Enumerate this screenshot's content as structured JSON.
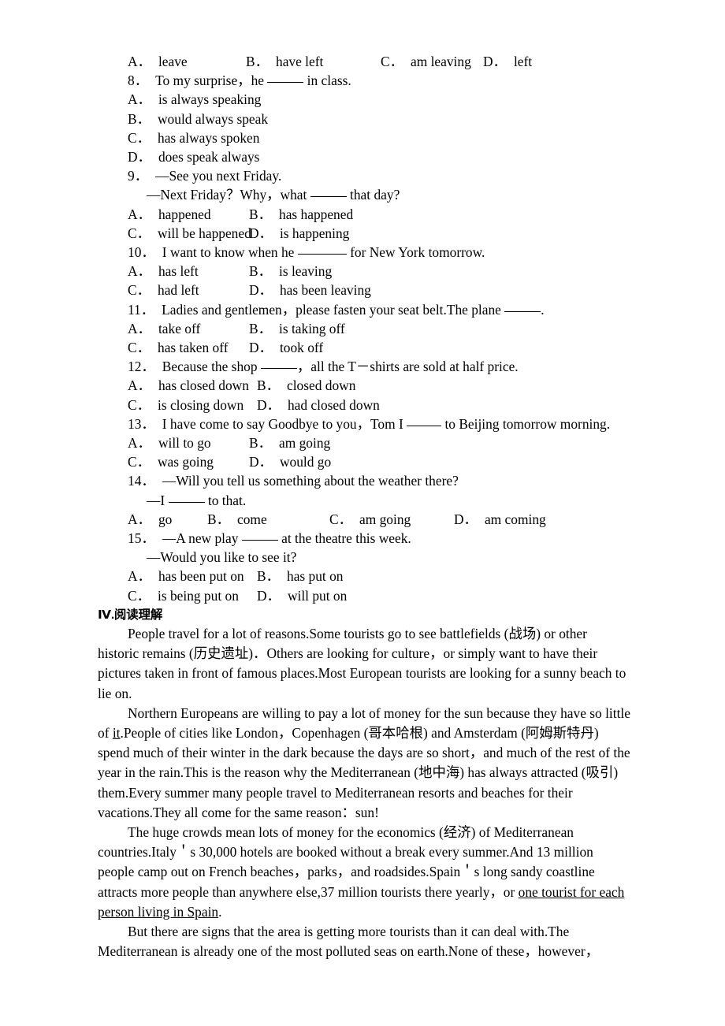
{
  "document": {
    "questions": [
      {
        "id": "q7-options",
        "type": "options-4col",
        "options": [
          {
            "key": "A．",
            "text": "leave"
          },
          {
            "key": "B．",
            "text": "have left"
          },
          {
            "key": "C．",
            "text": "am leaving"
          },
          {
            "key": "D．",
            "text": "left"
          }
        ]
      },
      {
        "id": "q8",
        "number": "8．",
        "stem_before": "To my surprise，he ",
        "stem_after": " in class.",
        "type": "stacked",
        "options": [
          {
            "key": "A．",
            "text": "is always speaking"
          },
          {
            "key": "B．",
            "text": "would always speak"
          },
          {
            "key": "C．",
            "text": "has always spoken"
          },
          {
            "key": "D．",
            "text": "does speak always"
          }
        ]
      },
      {
        "id": "q9",
        "number": "9．",
        "stem_line1": "—See you next Friday.",
        "stem_line2_before": "—Next Friday？Why，what ",
        "stem_line2_after": " that day?",
        "type": "2col",
        "options": [
          {
            "key": "A．",
            "text": "happened"
          },
          {
            "key": "B．",
            "text": "has happened"
          },
          {
            "key": "C．",
            "text": "will be happened"
          },
          {
            "key": "D．",
            "text": "is happening"
          }
        ]
      },
      {
        "id": "q10",
        "number": "10．",
        "stem_before": "I want to know when he ",
        "stem_after": " for New York tomorrow.",
        "type": "2col",
        "options": [
          {
            "key": "A．",
            "text": "has left"
          },
          {
            "key": "B．",
            "text": "is leaving"
          },
          {
            "key": "C．",
            "text": "had left"
          },
          {
            "key": "D．",
            "text": "has been leaving"
          }
        ]
      },
      {
        "id": "q11",
        "number": "11．",
        "stem_before": "Ladies and gentlemen，please fasten your seat belt.The plane ",
        "stem_after": ".",
        "type": "2col",
        "options": [
          {
            "key": "A．",
            "text": "take off"
          },
          {
            "key": "B．",
            "text": "is taking off"
          },
          {
            "key": "C．",
            "text": "has taken off"
          },
          {
            "key": "D．",
            "text": "took off"
          }
        ]
      },
      {
        "id": "q12",
        "number": "12．",
        "stem_before": "Because the shop ",
        "stem_after": "，all the T－shirts are sold at half price.",
        "type": "2col",
        "options": [
          {
            "key": "A．",
            "text": "has closed down"
          },
          {
            "key": "B．",
            "text": "closed down"
          },
          {
            "key": "C．",
            "text": "is closing down"
          },
          {
            "key": "D．",
            "text": "had closed down"
          }
        ]
      },
      {
        "id": "q13",
        "number": "13．",
        "stem_before": "I have come to say Goodbye to you，Tom I ",
        "stem_after": " to Beijing tomorrow morning.",
        "type": "2col",
        "options": [
          {
            "key": "A．",
            "text": "will to go"
          },
          {
            "key": "B．",
            "text": "am going"
          },
          {
            "key": "C．",
            "text": "was going"
          },
          {
            "key": "D．",
            "text": "would go"
          }
        ]
      },
      {
        "id": "q14",
        "number": "14．",
        "stem_line1": "—Will you tell us something about the weather there?",
        "stem_line2_before": "—I ",
        "stem_line2_after": " to that.",
        "type": "options-4col",
        "options": [
          {
            "key": "A．",
            "text": "go"
          },
          {
            "key": "B．",
            "text": "come"
          },
          {
            "key": "C．",
            "text": "am going"
          },
          {
            "key": "D．",
            "text": "am coming"
          }
        ]
      },
      {
        "id": "q15",
        "number": "15．",
        "stem_line1_before": "—A new play ",
        "stem_line1_after": " at the theatre this week.",
        "stem_line2": "—Would you like to see it?",
        "type": "2col",
        "options": [
          {
            "key": "A．",
            "text": "has been put on"
          },
          {
            "key": "B．",
            "text": "has put on"
          },
          {
            "key": "C．",
            "text": "is being put on"
          },
          {
            "key": "D．",
            "text": "will put on"
          }
        ]
      }
    ],
    "section_heading": "Ⅳ.阅读理解",
    "passage": {
      "p1": "People travel for a lot of reasons.Some tourists go to see battlefields (战场) or other historic remains (历史遗址)．Others are looking for culture，or simply want to have their pictures taken in front of famous places.Most European tourists are looking for a sunny beach to lie on.",
      "p2_a": "Northern Europeans are willing to pay a lot of money for the sun because they have so little of ",
      "p2_underline": "it",
      "p2_b": ".People of cities like London，Copenhagen (哥本哈根) and Amsterdam (阿姆斯特丹) spend much of their winter in the dark because the days are so short，and much of the rest of the year in the rain.This is the reason why the Mediterranean (地中海) has always attracted (吸引) them.Every summer many people travel to Mediterranean resorts and beaches for their vacations.They all come for the same reason：sun!",
      "p3_a": "The huge crowds mean lots of money for the economics (经济) of Mediterranean countries.Italy＇s 30,000 hotels are booked without a break every summer.And 13 million people camp out on French beaches，parks，and roadsides.Spain＇s long sandy coastline attracts more people than anywhere else,37 million tourists there yearly，or ",
      "p3_underline": "one tourist for each person living in Spain",
      "p3_b": ".",
      "p4": "But there are signs that the area is getting more tourists than it can deal with.The Mediterranean is already one of the most polluted seas on earth.None of these，however，"
    }
  }
}
